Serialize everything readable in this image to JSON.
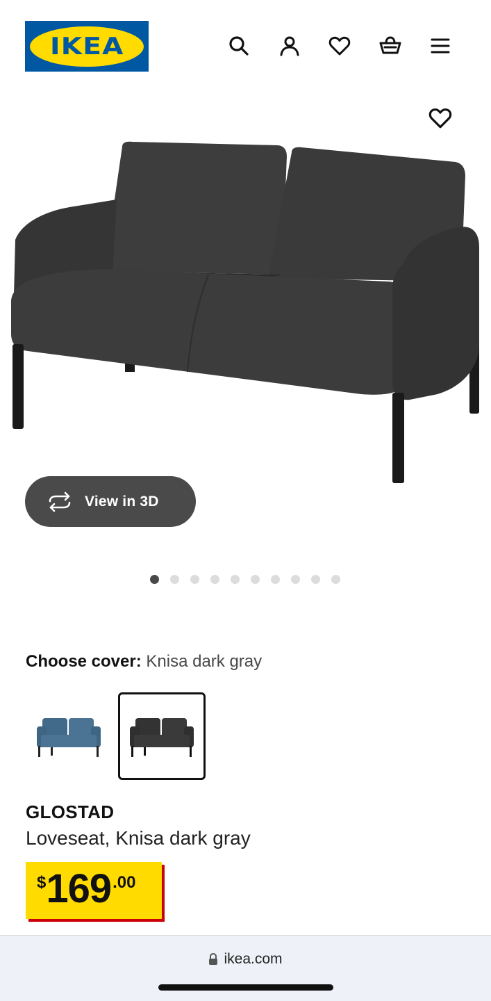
{
  "header": {
    "logo_text": "IKEA",
    "icons": [
      "search-icon",
      "account-icon",
      "heart-icon",
      "basket-icon",
      "menu-icon"
    ]
  },
  "product": {
    "view_3d_label": "View in 3D",
    "gallery_count": 10,
    "gallery_active_index": 0,
    "cover_label": "Choose cover:",
    "cover_value": "Knisa dark gray",
    "cover_options": [
      {
        "color": "#4a7394",
        "selected": false
      },
      {
        "color": "#3a3a3a",
        "selected": true
      }
    ],
    "name": "GLOSTAD",
    "description": "Loveseat, Knisa dark gray",
    "price": {
      "currency": "$",
      "integer": "169",
      "decimal": ".00"
    }
  },
  "browser": {
    "url": "ikea.com"
  },
  "colors": {
    "ikea_blue": "#0058a3",
    "ikea_yellow": "#ffdb00",
    "price_shadow": "#cc0008",
    "sofa_dark": "#3a3a3a"
  }
}
